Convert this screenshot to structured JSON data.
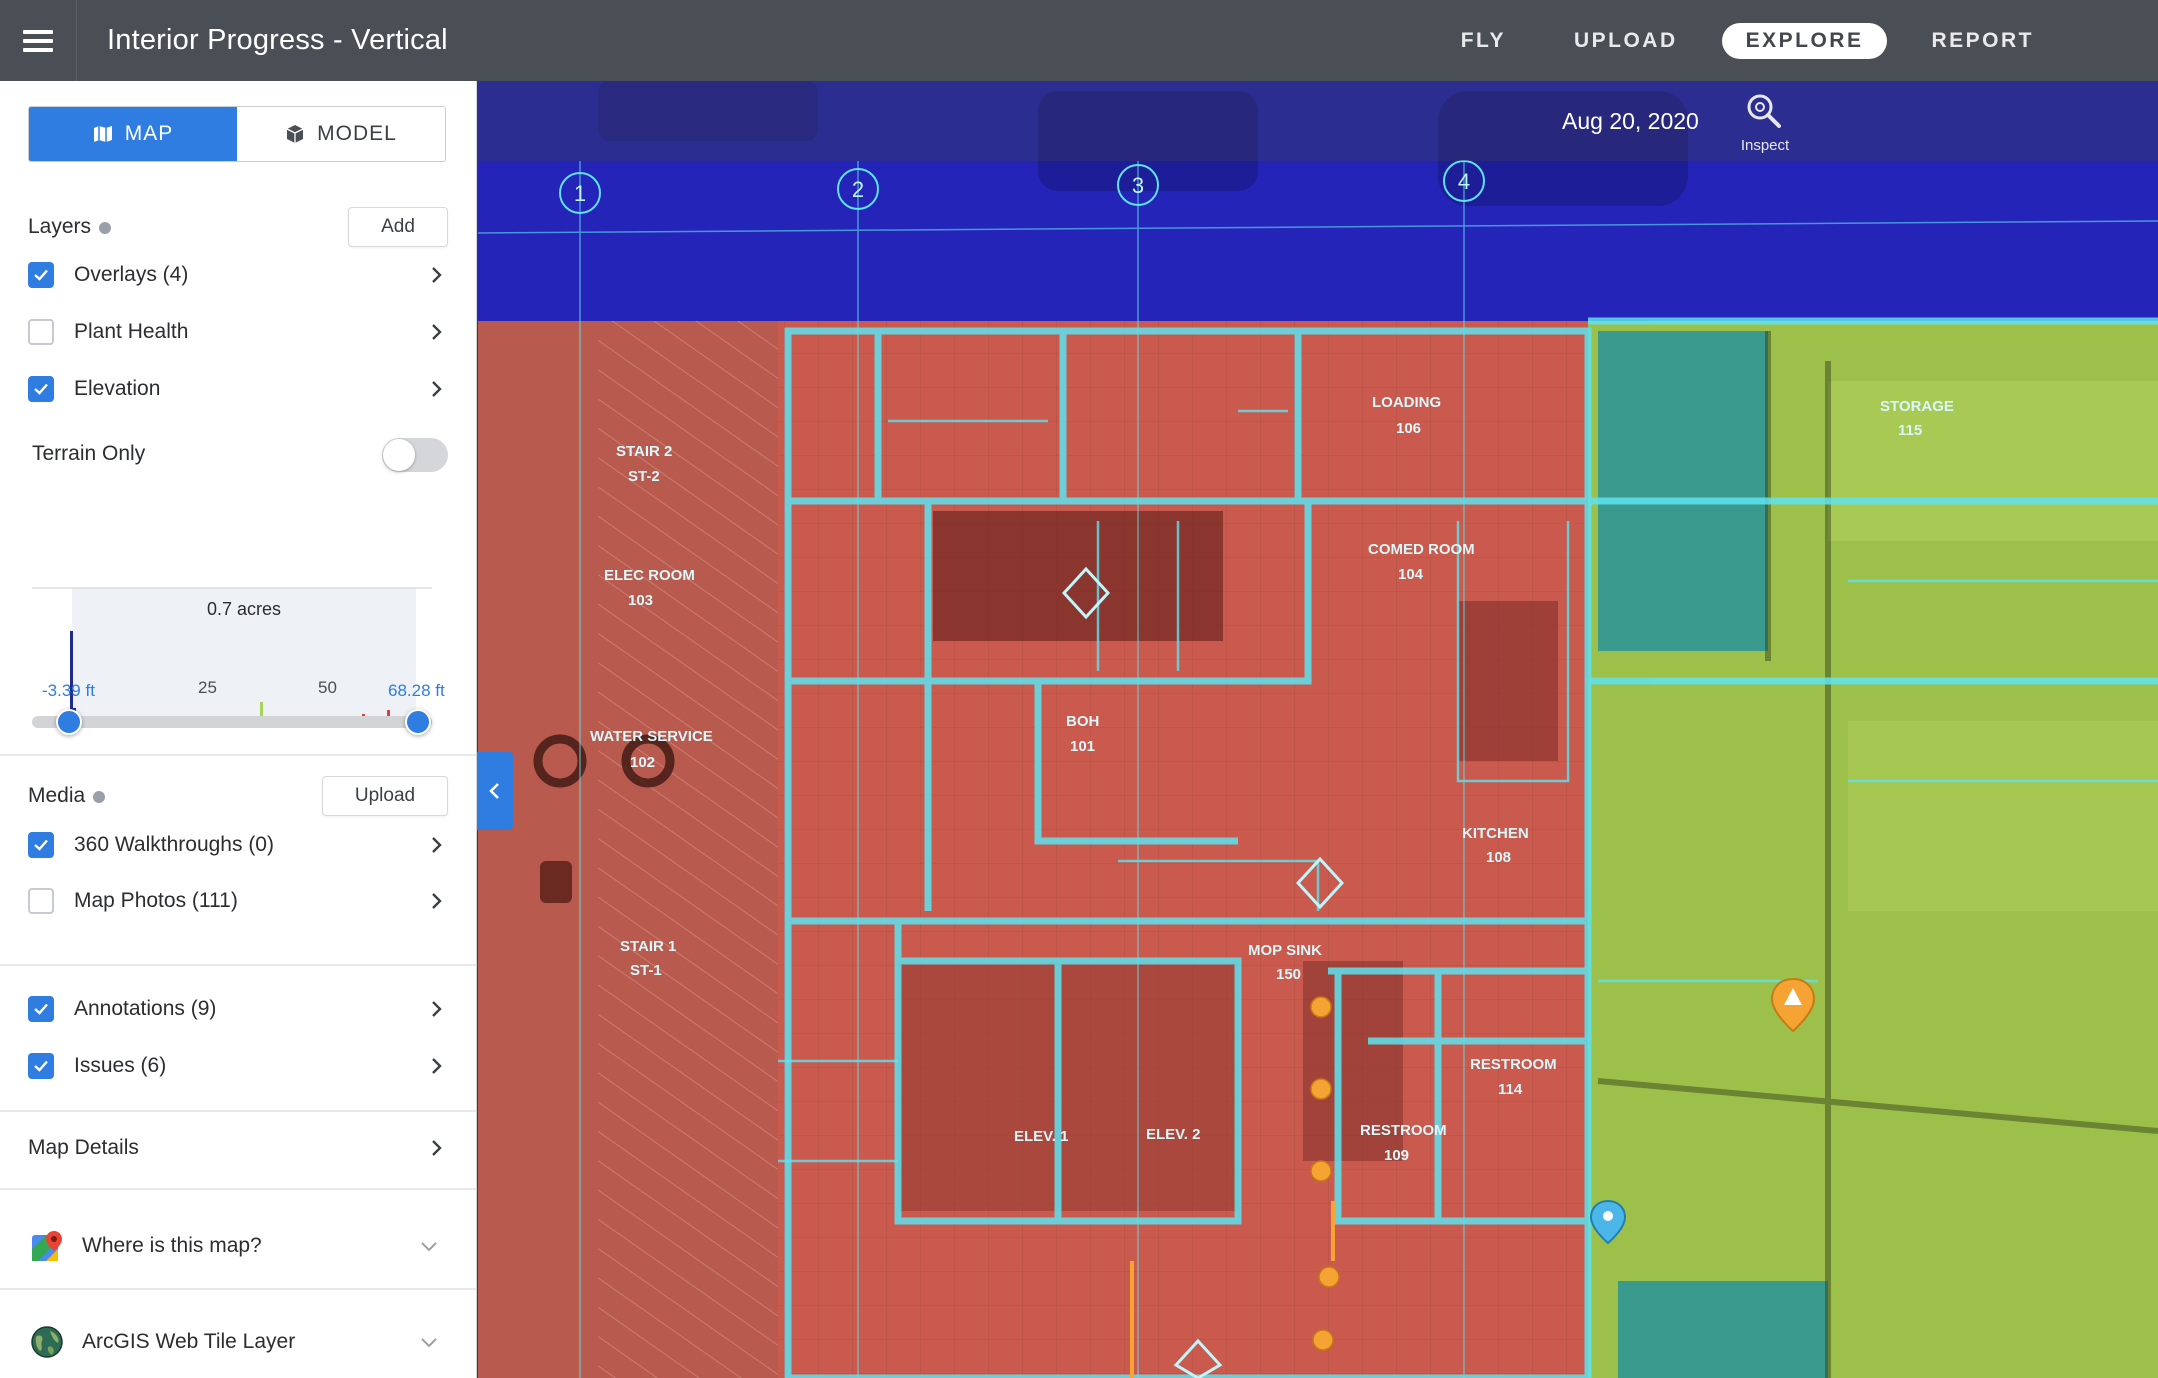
{
  "header": {
    "title": "Interior Progress - Vertical",
    "nav": [
      {
        "label": "FLY",
        "active": false
      },
      {
        "label": "UPLOAD",
        "active": false
      },
      {
        "label": "EXPLORE",
        "active": true
      },
      {
        "label": "REPORT",
        "active": false
      }
    ]
  },
  "sidebar": {
    "view_toggle": {
      "map_label": "MAP",
      "model_label": "MODEL",
      "active": "MAP"
    },
    "layers": {
      "title": "Layers",
      "add_label": "Add",
      "items": [
        {
          "label": "Overlays (4)",
          "checked": true
        },
        {
          "label": "Plant Health",
          "checked": false
        },
        {
          "label": "Elevation",
          "checked": true
        }
      ],
      "terrain_only": {
        "label": "Terrain Only",
        "on": false
      }
    },
    "elevation": {
      "area_label": "0.7 acres",
      "min_label": "-3.39 ft",
      "max_label": "68.28 ft",
      "ticks": [
        "25",
        "50"
      ],
      "range_low": 0.0,
      "range_high": 1.0
    },
    "media": {
      "title": "Media",
      "upload_label": "Upload",
      "items": [
        {
          "label": "360 Walkthroughs (0)",
          "checked": true
        },
        {
          "label": "Map Photos (111)",
          "checked": false
        }
      ]
    },
    "annotations": {
      "items": [
        {
          "label": "Annotations (9)",
          "checked": true
        },
        {
          "label": "Issues (6)",
          "checked": true
        }
      ]
    },
    "map_details": {
      "label": "Map Details"
    },
    "footer": [
      {
        "label": "Where is this map?",
        "icon": "google-maps-icon"
      },
      {
        "label": "ArcGIS Web Tile Layer",
        "icon": "globe-icon"
      }
    ]
  },
  "map": {
    "date": "Aug 20, 2020",
    "inspect_label": "Inspect",
    "grid_labels": [
      "1",
      "2",
      "3",
      "4"
    ],
    "room_labels": [
      {
        "name": "STAIR 2",
        "num": "ST-2"
      },
      {
        "name": "LOADING",
        "num": "106"
      },
      {
        "name": "STORAGE",
        "num": "115"
      },
      {
        "name": "ELEC ROOM",
        "num": "103"
      },
      {
        "name": "COMED ROOM",
        "num": "104"
      },
      {
        "name": "WATER SERVICE",
        "num": "102"
      },
      {
        "name": "BOH",
        "num": "101"
      },
      {
        "name": "KITCHEN",
        "num": "108"
      },
      {
        "name": "STAIR 1",
        "num": "ST-1"
      },
      {
        "name": "MOP SINK",
        "num": "150"
      },
      {
        "name": "RESTROOM",
        "num": "114"
      },
      {
        "name": "RESTROOM",
        "num": "109"
      },
      {
        "name": "ELEV. 1",
        "num": ""
      },
      {
        "name": "ELEV. 2",
        "num": ""
      }
    ],
    "colors": {
      "blue_zone": "#2424b8",
      "red_zone": "#c95a4d",
      "green_zone": "#9cc04a",
      "teal_zone": "#3a9a8e",
      "plan_lines": "#5ee3f0",
      "marker_orange": "#f5a433",
      "marker_blue": "#4db6e8"
    }
  }
}
